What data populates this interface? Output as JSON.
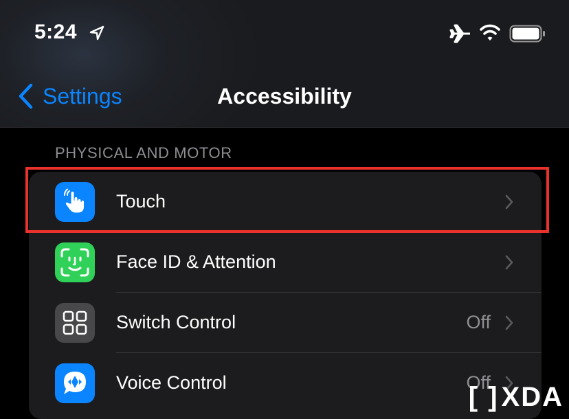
{
  "status_bar": {
    "time": "5:24",
    "icons": [
      "location-arrow-icon",
      "airplane-mode-icon",
      "wifi-icon",
      "battery-icon"
    ]
  },
  "nav": {
    "back_label": "Settings",
    "title": "Accessibility"
  },
  "section": {
    "header": "PHYSICAL AND MOTOR",
    "rows": [
      {
        "label": "Touch",
        "value": "",
        "icon": "touch-hand-icon",
        "icon_color": "#0a84ff"
      },
      {
        "label": "Face ID & Attention",
        "value": "",
        "icon": "face-id-icon",
        "icon_color": "#30d158"
      },
      {
        "label": "Switch Control",
        "value": "Off",
        "icon": "switch-control-icon",
        "icon_color": "#48484a"
      },
      {
        "label": "Voice Control",
        "value": "Off",
        "icon": "voice-control-icon",
        "icon_color": "#0a84ff"
      }
    ]
  },
  "colors": {
    "accent": "#0a84ff",
    "highlight_box": "#e8322b",
    "background": "#000000",
    "cell_background": "#1c1c1e"
  },
  "watermark": {
    "text": "XDA"
  }
}
